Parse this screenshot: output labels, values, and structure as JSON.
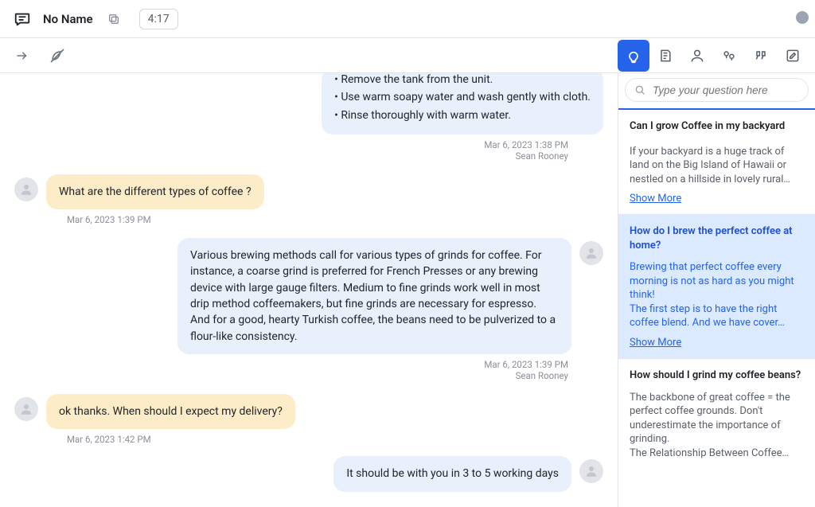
{
  "header": {
    "title": "No Name",
    "timer": "4:17"
  },
  "chat": {
    "agent_bullets": [
      "• Remove the tank from the unit.",
      "• Use warm soapy water and wash gently with cloth.",
      "• Rinse thoroughly with warm water."
    ],
    "m1_time": "Mar 6, 2023 1:38 PM",
    "m1_author": "Sean Rooney",
    "cust1": "What are the different types of coffee ?",
    "cust1_time": "Mar 6, 2023 1:39 PM",
    "agent2": "Various brewing methods call for various types of grinds for coffee. For instance, a coarse grind is preferred for French Presses or any brewing device with large gauge filters. Medium to fine grinds work well in most drip method coffeemakers, but fine grinds are necessary for espresso. And for a good, hearty Turkish coffee, the beans need to be pulverized to a flour-like consistency.",
    "m2_time": "Mar 6, 2023 1:39 PM",
    "m2_author": "Sean Rooney",
    "cust2": "ok thanks. When should I expect my delivery?",
    "cust2_time": "Mar 6, 2023 1:42 PM",
    "agent3": "It should be with you in 3 to 5 working days"
  },
  "knowledge": {
    "search_placeholder": "Type your question here",
    "cards": {
      "c1_title": "Can I grow Coffee in my backyard",
      "c1_body": "If your backyard is a huge track of land on the Big Island of Hawaii or nestled on a hillside in lovely rural…",
      "c1_more": "Show More",
      "c2_title": "How do I brew the perfect coffee at home?",
      "c2_body1": "Brewing that perfect coffee every morning is not as hard as you might think!",
      "c2_body2": "The first step is to have the right coffee blend. And we have cover…",
      "c2_more": "Show More",
      "c3_title": "How should I grind my coffee beans?",
      "c3_body1": "The backbone of great coffee = the perfect coffee grounds. Don't underestimate the importance of grinding.",
      "c3_body2": "The Relationship Between Coffee…"
    }
  }
}
